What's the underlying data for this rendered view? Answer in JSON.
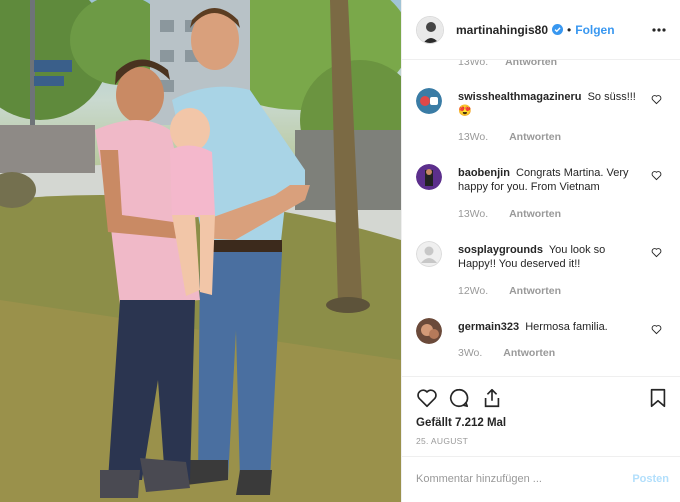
{
  "header": {
    "username": "martinahingis80",
    "separator": "•",
    "follow_label": "Folgen",
    "verified_icon": "verified-badge-icon",
    "more_icon": "more-options-icon"
  },
  "comments": {
    "top_partial": {
      "time": "13Wo.",
      "reply_label": "Antworten"
    },
    "items": [
      {
        "username": "swisshealthmagazineru",
        "text": "So süss!!! 😍",
        "time": "13Wo.",
        "reply_label": "Antworten"
      },
      {
        "username": "baobenjin",
        "text": "Congrats Martina. Very happy for you. From Vietnam",
        "time": "13Wo.",
        "reply_label": "Antworten"
      },
      {
        "username": "sosplaygrounds",
        "text": "You look so Happy!! You deserved it!!",
        "time": "12Wo.",
        "reply_label": "Antworten"
      },
      {
        "username": "germain323",
        "text": "Hermosa familia.",
        "time": "3Wo.",
        "reply_label": "Antworten"
      }
    ]
  },
  "actions": {
    "like_icon": "heart-icon",
    "comment_icon": "comment-bubble-icon",
    "share_icon": "share-icon",
    "save_icon": "bookmark-icon",
    "likes_text": "Gefällt 7.212 Mal",
    "date": "25. AUGUST"
  },
  "comment_box": {
    "placeholder": "Kommentar hinzufügen ...",
    "post_label": "Posten"
  },
  "colors": {
    "link_blue": "#3897f0",
    "post_disabled": "#b2dffc",
    "muted": "#999999",
    "text": "#262626"
  }
}
